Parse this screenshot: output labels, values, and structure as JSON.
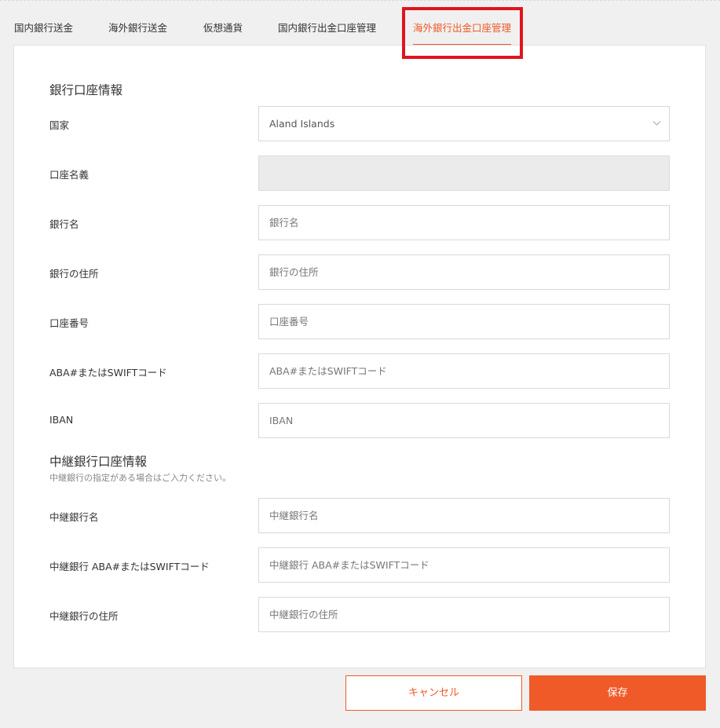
{
  "tabs": [
    {
      "label": "国内銀行送金"
    },
    {
      "label": "海外銀行送金"
    },
    {
      "label": "仮想通貨"
    },
    {
      "label": "国内銀行出金口座管理"
    },
    {
      "label": "海外銀行出金口座管理"
    }
  ],
  "active_tab": "海外銀行出金口座管理",
  "section_bank": {
    "title": "銀行口座情報"
  },
  "fields": {
    "country": {
      "label": "国家",
      "value": "Aland Islands"
    },
    "account_holder": {
      "label": "口座名義",
      "value": ""
    },
    "bank_name": {
      "label": "銀行名",
      "placeholder": "銀行名"
    },
    "bank_address": {
      "label": "銀行の住所",
      "placeholder": "銀行の住所"
    },
    "account_number": {
      "label": "口座番号",
      "placeholder": "口座番号"
    },
    "swift": {
      "label": "ABA#またはSWIFTコード",
      "placeholder": "ABA#またはSWIFTコード"
    },
    "iban": {
      "label": "IBAN",
      "placeholder": "IBAN"
    }
  },
  "section_intermediary": {
    "title": "中継銀行口座情報",
    "note": "中継銀行の指定がある場合はご入力ください。"
  },
  "intermediary_fields": {
    "bank_name": {
      "label": "中継銀行名",
      "placeholder": "中継銀行名"
    },
    "swift": {
      "label": "中継銀行 ABA#またはSWIFTコード",
      "placeholder": "中継銀行 ABA#またはSWIFTコード"
    },
    "address": {
      "label": "中継銀行の住所",
      "placeholder": "中継銀行の住所"
    }
  },
  "buttons": {
    "cancel": "キャンセル",
    "save": "保存"
  },
  "colors": {
    "accent": "#f05a28",
    "highlight": "#e0141e"
  },
  "icons": {
    "select_arrow": "chevron-down-icon"
  }
}
